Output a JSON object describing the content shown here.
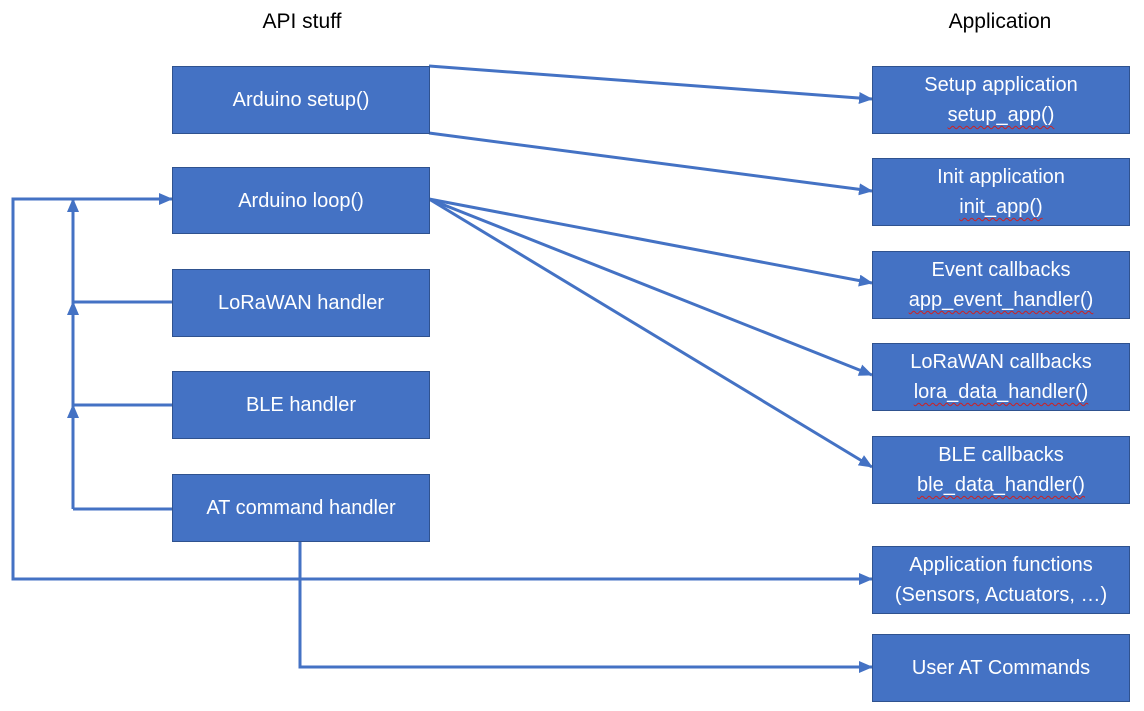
{
  "headings": {
    "api": "API stuff",
    "application": "Application"
  },
  "api_boxes": [
    {
      "id": "arduino-setup",
      "label": "Arduino setup()"
    },
    {
      "id": "arduino-loop",
      "label": "Arduino loop()"
    },
    {
      "id": "lorawan-handler",
      "label": "LoRaWAN handler"
    },
    {
      "id": "ble-handler",
      "label": "BLE handler"
    },
    {
      "id": "at-command-handler",
      "label": "AT command handler"
    }
  ],
  "app_boxes": [
    {
      "id": "setup-application",
      "title": "Setup application",
      "function": "setup_app()"
    },
    {
      "id": "init-application",
      "title": "Init application",
      "function": "init_app()"
    },
    {
      "id": "event-callbacks",
      "title": "Event callbacks",
      "function": "app_event_handler()"
    },
    {
      "id": "lorawan-callbacks",
      "title": "LoRaWAN callbacks",
      "function": "lora_data_handler()"
    },
    {
      "id": "ble-callbacks",
      "title": "BLE callbacks",
      "function": "ble_data_handler()"
    },
    {
      "id": "application-functions",
      "title": "Application functions",
      "function": "(Sensors, Actuators, …)"
    },
    {
      "id": "user-at-commands",
      "title": "User AT Commands",
      "function": ""
    }
  ],
  "connections": [
    {
      "from": "arduino-setup",
      "to": "setup-application"
    },
    {
      "from": "arduino-setup",
      "to": "init-application"
    },
    {
      "from": "arduino-loop",
      "to": "event-callbacks"
    },
    {
      "from": "arduino-loop",
      "to": "lorawan-callbacks"
    },
    {
      "from": "arduino-loop",
      "to": "ble-callbacks"
    },
    {
      "from": "lorawan-handler",
      "to": "arduino-loop"
    },
    {
      "from": "ble-handler",
      "to": "arduino-loop"
    },
    {
      "from": "at-command-handler",
      "to": "arduino-loop"
    },
    {
      "from": "arduino-loop",
      "to": "application-functions"
    },
    {
      "from": "at-command-handler",
      "to": "user-at-commands"
    }
  ],
  "colors": {
    "box_fill": "#4472c4",
    "box_border": "#2f528f",
    "line": "#4472c4",
    "text": "#ffffff",
    "heading_text": "#000000"
  }
}
